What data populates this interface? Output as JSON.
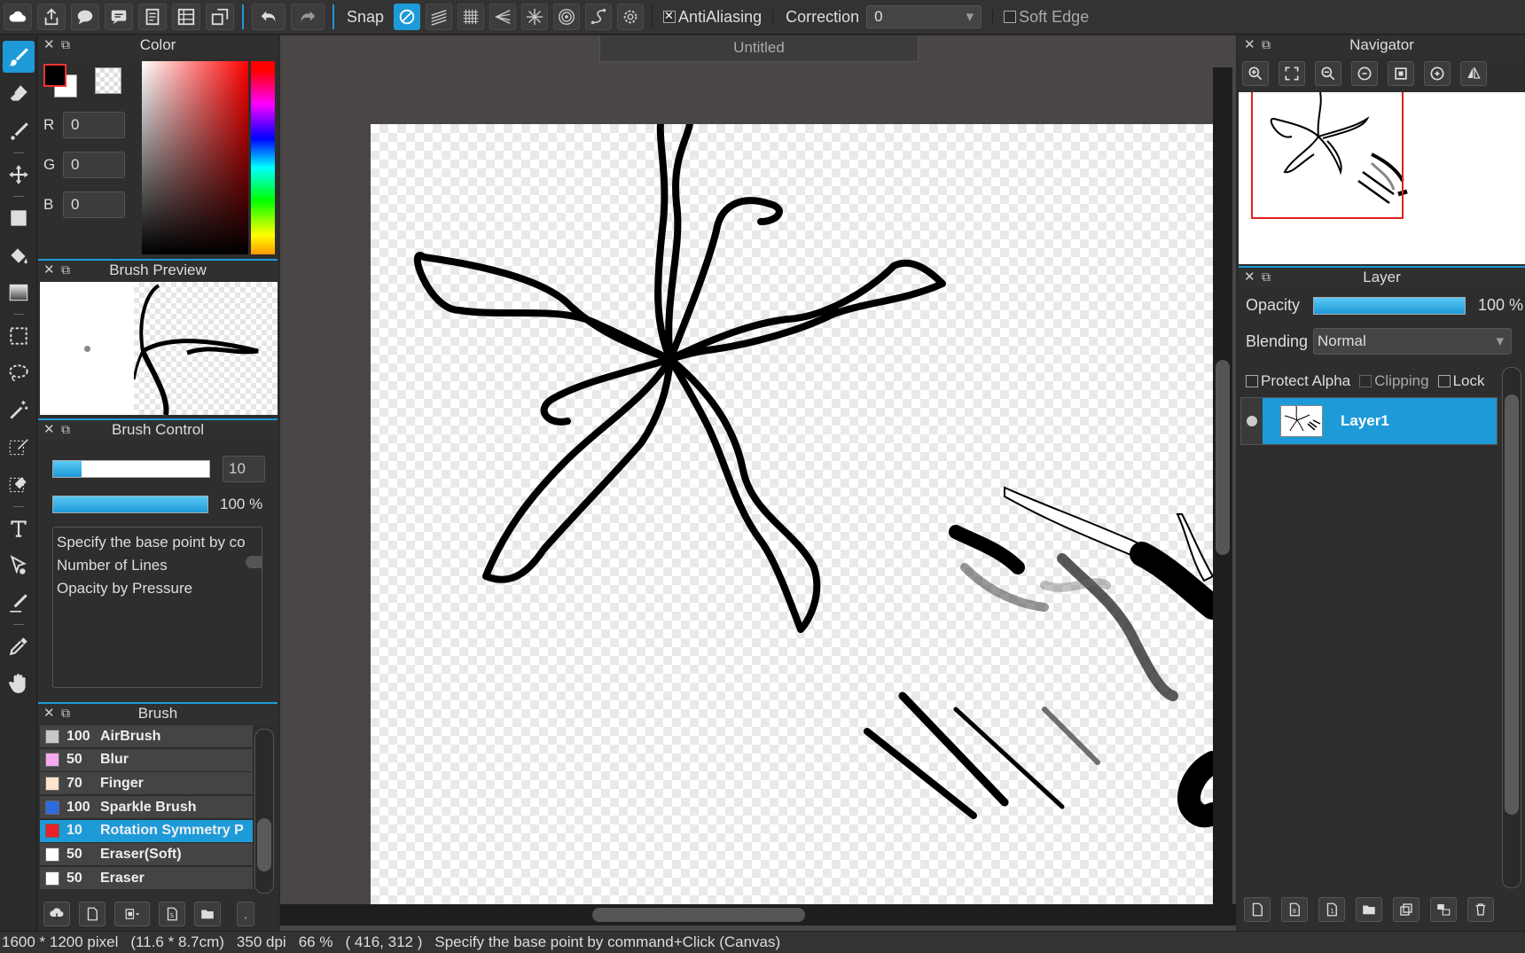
{
  "toolbar": {
    "snap_label": "Snap",
    "antialiasing_label": "AntiAliasing",
    "antialiasing_checked": true,
    "correction_label": "Correction",
    "correction_value": "0",
    "soft_edge_label": "Soft Edge",
    "soft_edge_checked": false
  },
  "panels": {
    "color_title": "Color",
    "brush_preview_title": "Brush Preview",
    "brush_control_title": "Brush Control",
    "brush_title": "Brush",
    "navigator_title": "Navigator",
    "layer_title": "Layer"
  },
  "color": {
    "r_label": "R",
    "r_value": "0",
    "g_label": "G",
    "g_value": "0",
    "b_label": "B",
    "b_value": "0",
    "foreground": "#000000",
    "background": "#ffffff"
  },
  "brush_control": {
    "size_value": "10",
    "size_fraction": 0.18,
    "opacity_text": "100 %",
    "opacity_fraction": 1.0,
    "options": [
      "Specify the base point by co",
      "Number of Lines",
      "Opacity by Pressure"
    ]
  },
  "brushes": [
    {
      "size": "100",
      "name": "AirBrush",
      "color": "#c8c8c8",
      "selected": false
    },
    {
      "size": "50",
      "name": "Blur",
      "color": "#f7a8f0",
      "selected": false
    },
    {
      "size": "70",
      "name": "Finger",
      "color": "#fde3cc",
      "selected": false
    },
    {
      "size": "100",
      "name": "Sparkle Brush",
      "color": "#2f6be0",
      "selected": false
    },
    {
      "size": "10",
      "name": "Rotation Symmetry P",
      "color": "#e8202a",
      "selected": true
    },
    {
      "size": "50",
      "name": "Eraser(Soft)",
      "color": "#ffffff",
      "selected": false
    },
    {
      "size": "50",
      "name": "Eraser",
      "color": "#ffffff",
      "selected": false
    }
  ],
  "document": {
    "tab_title": "Untitled"
  },
  "layer": {
    "opacity_label": "Opacity",
    "opacity_text": "100 %",
    "blending_label": "Blending",
    "blending_value": "Normal",
    "protect_alpha_label": "Protect Alpha",
    "clipping_label": "Clipping",
    "lock_label": "Lock",
    "layers": [
      {
        "name": "Layer1",
        "visible": true,
        "selected": true
      }
    ]
  },
  "status": {
    "pixel_size": "1600 * 1200 pixel",
    "cm_size": "(11.6 * 8.7cm)",
    "dpi": "350 dpi",
    "zoom": "66 %",
    "cursor": "( 416, 312 )",
    "hint": "Specify the base point by command+Click (Canvas)"
  },
  "theme": {
    "accent": "#1e9ad8",
    "panel_bg": "#2e2e2e",
    "workspace_bg": "#4a4646"
  }
}
